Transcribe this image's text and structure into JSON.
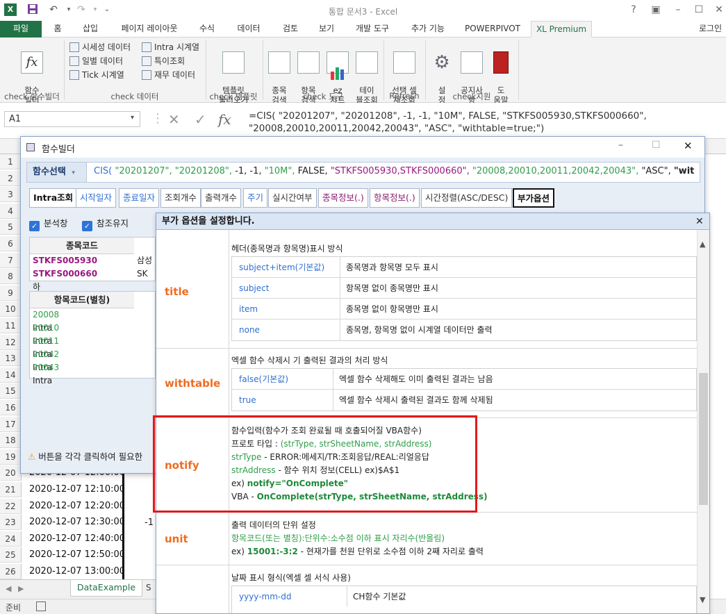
{
  "window": {
    "title": "통합 문서3 - Excel",
    "help": "?",
    "login": "로그인"
  },
  "ribbon_tabs": [
    {
      "label": "파일"
    },
    {
      "label": "홈"
    },
    {
      "label": "삽입"
    },
    {
      "label": "페이지 레이아웃"
    },
    {
      "label": "수식"
    },
    {
      "label": "데이터"
    },
    {
      "label": "검토"
    },
    {
      "label": "보기"
    },
    {
      "label": "개발 도구"
    },
    {
      "label": "추가 기능"
    },
    {
      "label": "POWERPIVOT"
    },
    {
      "label": "XL Premium"
    }
  ],
  "ribbon": {
    "func_builder": {
      "label": "함수\n빌더",
      "group": "check 함수빌더"
    },
    "data_group": {
      "items": [
        "시세성 데이터",
        "일별 데이터",
        "Tick 시계열",
        "Intra 시계열",
        "특이조회",
        "재무 데이터"
      ],
      "group": "check 데이터"
    },
    "template_group": {
      "label": "템플릿\n불러오기",
      "group": "check 템플릿"
    },
    "tool_group": {
      "items": [
        "종목\n검색",
        "항목\n검색",
        "ez\n챠트",
        "테이\n블조회"
      ],
      "group": "check 도구"
    },
    "refresh_group": {
      "label": "선택 셀\n재조회",
      "group": "Refresh"
    },
    "support_group": {
      "items": [
        "설\n정",
        "공지사\n항",
        "도\n움말"
      ],
      "group": "check지원"
    }
  },
  "formula_bar": {
    "name_box": "A1",
    "formula": "=CIS( \"20201207\", \"20201208\", -1, -1, \"10M\", FALSE, \"STKFS005930,STKFS000660\", \"20008,20010,20011,20042,20043\", \"ASC\", \"withtable=true;\")"
  },
  "sheet": {
    "rows": [
      {
        "n": "1",
        "val": ""
      },
      {
        "n": "2",
        "val": ""
      },
      {
        "n": "3",
        "val": ""
      },
      {
        "n": "4",
        "val": ""
      },
      {
        "n": "5",
        "val": ""
      },
      {
        "n": "6",
        "val": ""
      },
      {
        "n": "7",
        "val": ""
      },
      {
        "n": "8",
        "val": ""
      },
      {
        "n": "9",
        "val": ""
      },
      {
        "n": "10",
        "val": ""
      },
      {
        "n": "11",
        "val": ""
      },
      {
        "n": "12",
        "val": ""
      },
      {
        "n": "13",
        "val": ""
      },
      {
        "n": "14",
        "val": ""
      },
      {
        "n": "15",
        "val": ""
      },
      {
        "n": "16",
        "val": ""
      },
      {
        "n": "17",
        "val": ""
      },
      {
        "n": "18",
        "val": ""
      },
      {
        "n": "19",
        "val": ""
      },
      {
        "n": "20",
        "val": "2020-12-07 12:00:00"
      },
      {
        "n": "21",
        "val": "2020-12-07 12:10:00"
      },
      {
        "n": "22",
        "val": "2020-12-07 12:20:00"
      },
      {
        "n": "23",
        "val": "2020-12-07 12:30:00"
      },
      {
        "n": "24",
        "val": "2020-12-07 12:40:00"
      },
      {
        "n": "25",
        "val": "2020-12-07 12:50:00"
      },
      {
        "n": "26",
        "val": "2020-12-07 13:00:00"
      }
    ],
    "row23_extra": "-1",
    "sheet_tab": "DataExample",
    "sheet_tab2": "S"
  },
  "status": {
    "ready": "준비"
  },
  "func_builder": {
    "title": "함수빌더",
    "fn_select": "함수선택",
    "fn_text_plain1": "CIS(",
    "fn_text_green1": "\"20201207\", \"20201208\",",
    "fn_text_plain2": "-1, -1,",
    "fn_text_green2": "\"10M\",",
    "fn_text_plain3": "FALSE,",
    "fn_text_purple": "\"STKFS005930,STKFS000660\",",
    "fn_text_green3": "\"20008,20010,20011,20042,20043\",",
    "fn_text_plain4": "\"ASC\",",
    "fn_text_bold": "\"wit",
    "tabs": [
      "Intra조회",
      "시작일자",
      "종료일자",
      "조회개수",
      "출력개수",
      "주기",
      "실시간여부",
      "종목정보(.)",
      "항목정보(.)",
      "시간정렬(ASC/DESC)",
      "부가옵션"
    ],
    "chk_analysis": "분석창",
    "chk_ref": "참조유지",
    "stock_header": "종목코드",
    "stocks": [
      {
        "code": "STKFS005930",
        "name": "삼성"
      },
      {
        "code": "STKFS000660",
        "name": "SK하"
      }
    ],
    "item_header": "항목코드(별칭)",
    "items": [
      {
        "code": "20008",
        "name": "Intra"
      },
      {
        "code": "20010",
        "name": "Intra"
      },
      {
        "code": "20011",
        "name": "Intra"
      },
      {
        "code": "20042",
        "name": "Intra"
      },
      {
        "code": "20043",
        "name": "Intra"
      }
    ],
    "warning": "버튼을 각각 클릭하여 필요한"
  },
  "addopt": {
    "title": "부가 옵션을 설정합니다.",
    "title_opt": {
      "name": "title",
      "desc": "헤더(종목명과 항목명)표시 방식",
      "rows": [
        {
          "k": "subject+item(기본값)",
          "v": "종목명과 항목명 모두 표시"
        },
        {
          "k": "subject",
          "v": "항목명 없이 종목명만 표시"
        },
        {
          "k": "item",
          "v": "종목명 없이 항목명만 표시"
        },
        {
          "k": "none",
          "v": "종목명, 항목명 없이 시계열 데이터만 출력"
        }
      ]
    },
    "withtable_opt": {
      "name": "withtable",
      "desc": "엑셀 함수 삭제시 기 출력된 결과의 처리 방식",
      "rows": [
        {
          "k": "false(기본값)",
          "v": "엑셀 함수 삭제해도 이미 출력된 결과는 남음"
        },
        {
          "k": "true",
          "v": "엑셀 함수 삭제시 출력된 결과도 함께 삭제됨"
        }
      ]
    },
    "notify_opt": {
      "name": "notify",
      "l1": "함수입력(함수가 조회 완료될 때 호출되어질 VBA함수)",
      "l2a": "프로토 타입 : ",
      "l2b": "(strType, strSheetName, strAddress)",
      "l3a": "strType",
      "l3b": " - ERROR:메세지/TR:조회응답/REAL:리얼응답",
      "l4a": "strAddress",
      "l4b": " - 함수 위치 정보(CELL) ex)$A$1",
      "l5a": "ex) ",
      "l5b": "notify=\"OnComplete\"",
      "l6a": "VBA - ",
      "l6b": "OnComplete(strType, strSheetName, strAddress)"
    },
    "unit_opt": {
      "name": "unit",
      "l1": "출력 데이터의 단위 설정",
      "l2": "항목코드(또는 별칭):단위수:소수점 이하 표시 자리수(반올림)",
      "l3a": "ex) ",
      "l3b": "15001:-3:2",
      "l3c": " - 현재가를 천원 단위로 소수점 이하 2째 자리로 출력"
    },
    "date_opt": {
      "desc": "날짜 표시 형식(엑셀 셀 서식 사용)",
      "rows": [
        {
          "k": "yyyy-mm-dd",
          "v": "CH함수 기본값"
        }
      ]
    }
  }
}
